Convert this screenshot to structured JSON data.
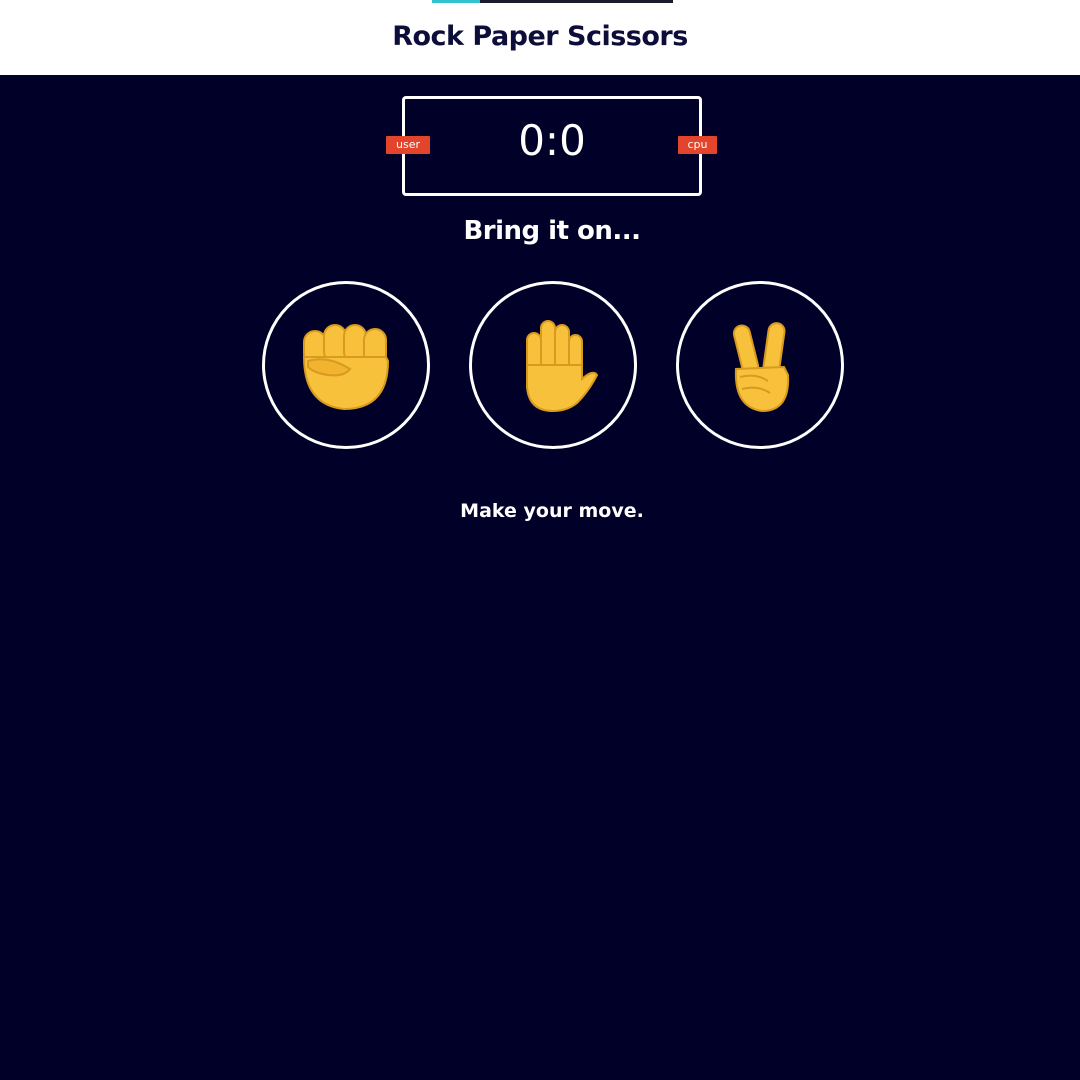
{
  "header": {
    "title": "Rock Paper Scissors"
  },
  "scoreboard": {
    "score": "0:0",
    "user_label": "user",
    "cpu_label": "cpu"
  },
  "subtitle": "Bring it on...",
  "choices": [
    {
      "id": "rock",
      "icon": "raised-fist-icon"
    },
    {
      "id": "paper",
      "icon": "raised-hand-icon"
    },
    {
      "id": "scissors",
      "icon": "victory-hand-icon"
    }
  ],
  "message": "Make your move.",
  "colors": {
    "background": "#000028",
    "header_background": "#ffffff",
    "title": "#0d0d3a",
    "badge": "#e2452b",
    "accent": "#31c3d2",
    "emoji": "#f7c13b"
  }
}
